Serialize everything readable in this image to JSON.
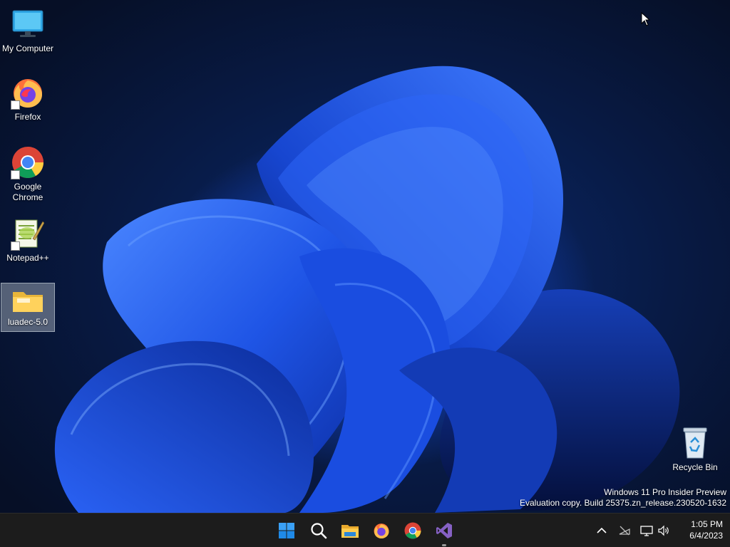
{
  "desktop": {
    "icons": [
      {
        "label": "My Computer",
        "icon": "monitor-icon"
      },
      {
        "label": "Firefox",
        "icon": "firefox-icon"
      },
      {
        "label": "Google Chrome",
        "icon": "chrome-icon"
      },
      {
        "label": "Notepad++",
        "icon": "notepadpp-icon"
      },
      {
        "label": "luadec-5.0",
        "icon": "folder-icon",
        "selected": true
      },
      {
        "label": "Recycle Bin",
        "icon": "recycle-bin-icon"
      }
    ],
    "watermark": {
      "line1": "Windows 11 Pro Insider Preview",
      "line2": "Evaluation copy. Build 25375.zn_release.230520-1632"
    }
  },
  "taskbar": {
    "apps": [
      {
        "icon": "windows-start-icon"
      },
      {
        "icon": "search-icon"
      },
      {
        "icon": "file-explorer-icon"
      },
      {
        "icon": "firefox-icon"
      },
      {
        "icon": "chrome-icon"
      },
      {
        "icon": "visual-studio-icon",
        "running": true
      }
    ],
    "tray": {
      "icons": [
        "chevron-up-icon",
        "network-disconnected-icon",
        "display-icon",
        "volume-icon"
      ],
      "time": "1:05 PM",
      "date": "6/4/2023"
    }
  },
  "colors": {
    "taskbar_bg": "#1c1c1c",
    "wallpaper_blue": "#1d4fd8",
    "wallpaper_dark": "#060f26"
  }
}
